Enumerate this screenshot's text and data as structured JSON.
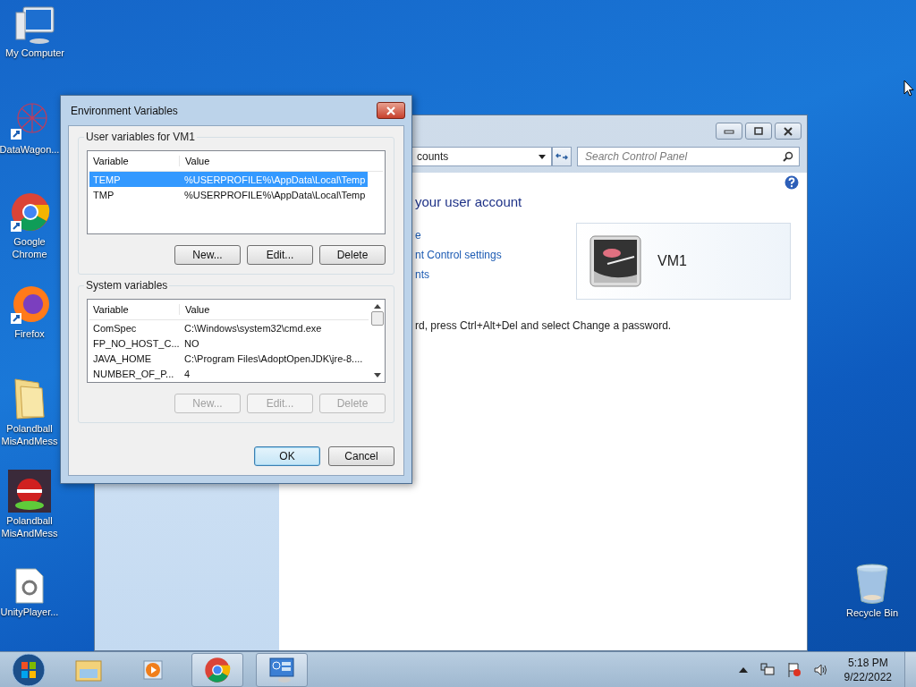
{
  "desktop_icons": [
    {
      "label": "My Computer"
    },
    {
      "label": "DataWagon..."
    },
    {
      "label": "Google Chrome"
    },
    {
      "label": "Firefox"
    },
    {
      "label": "Polandball MisAndMess"
    },
    {
      "label": "Polandball MisAndMess"
    },
    {
      "label": "UnityPlayer..."
    }
  ],
  "recycle_bin": {
    "label": "Recycle Bin"
  },
  "control_panel": {
    "address": "counts",
    "search": {
      "placeholder": "Search Control Panel"
    },
    "heading": "your user account",
    "links": [
      "e",
      "nt Control settings",
      "nts"
    ],
    "account_name": "VM1",
    "note": "rd, press Ctrl+Alt+Del and select Change a password."
  },
  "dialog": {
    "title": "Environment Variables",
    "user_variables": {
      "legend": "User variables for VM1",
      "columns": [
        "Variable",
        "Value"
      ],
      "rows": [
        {
          "variable": "TEMP",
          "value": "%USERPROFILE%\\AppData\\Local\\Temp",
          "selected": true
        },
        {
          "variable": "TMP",
          "value": "%USERPROFILE%\\AppData\\Local\\Temp",
          "selected": false
        }
      ],
      "buttons": [
        {
          "label": "New...",
          "disabled": false
        },
        {
          "label": "Edit...",
          "disabled": false
        },
        {
          "label": "Delete",
          "disabled": false
        }
      ]
    },
    "system_variables": {
      "legend": "System variables",
      "columns": [
        "Variable",
        "Value"
      ],
      "rows": [
        {
          "variable": "ComSpec",
          "value": "C:\\Windows\\system32\\cmd.exe",
          "selected": false
        },
        {
          "variable": "FP_NO_HOST_C...",
          "value": "NO",
          "selected": false
        },
        {
          "variable": "JAVA_HOME",
          "value": "C:\\Program Files\\AdoptOpenJDK\\jre-8....",
          "selected": false
        },
        {
          "variable": "NUMBER_OF_P...",
          "value": "4",
          "selected": false
        }
      ],
      "buttons": [
        {
          "label": "New...",
          "disabled": true
        },
        {
          "label": "Edit...",
          "disabled": true
        },
        {
          "label": "Delete",
          "disabled": true
        }
      ]
    },
    "buttons": [
      {
        "label": "OK",
        "default": true
      },
      {
        "label": "Cancel",
        "default": false
      }
    ]
  },
  "taskbar": {
    "items": [
      {
        "open": false
      },
      {
        "open": false
      },
      {
        "open": true
      },
      {
        "open": true
      }
    ],
    "time": "5:18 PM",
    "date": "9/22/2022"
  }
}
